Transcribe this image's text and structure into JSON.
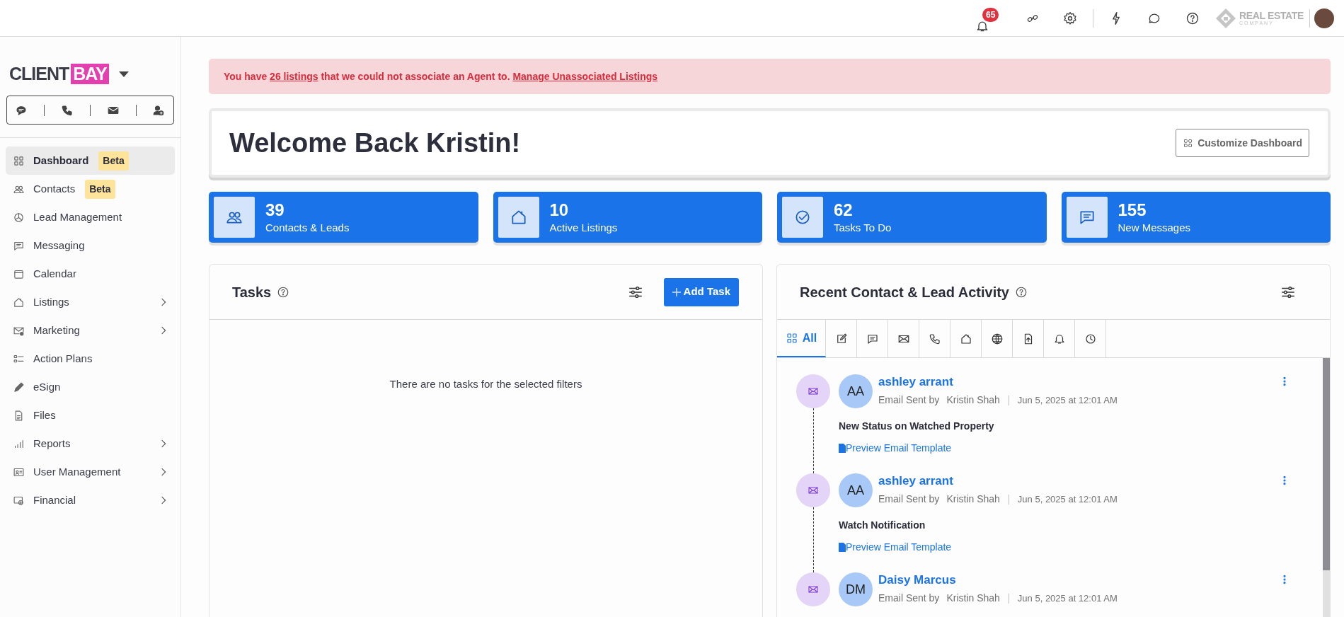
{
  "top_bar": {
    "notification_count": "65",
    "brand": {
      "name": "REAL ESTATE",
      "tagline": "COMPANY"
    }
  },
  "sidebar": {
    "logo": {
      "part_1": "CLIENT",
      "part_2": "BAY"
    },
    "items": [
      {
        "label": "Dashboard",
        "badge": "Beta",
        "selected": true,
        "has_submenu": false
      },
      {
        "label": "Contacts",
        "badge": "Beta",
        "selected": false,
        "has_submenu": false
      },
      {
        "label": "Lead Management",
        "selected": false,
        "has_submenu": false
      },
      {
        "label": "Messaging",
        "selected": false,
        "has_submenu": false
      },
      {
        "label": "Calendar",
        "selected": false,
        "has_submenu": false
      },
      {
        "label": "Listings",
        "selected": false,
        "has_submenu": true
      },
      {
        "label": "Marketing",
        "selected": false,
        "has_submenu": true
      },
      {
        "label": "Action Plans",
        "selected": false,
        "has_submenu": false
      },
      {
        "label": "eSign",
        "selected": false,
        "has_submenu": false
      },
      {
        "label": "Files",
        "selected": false,
        "has_submenu": false
      },
      {
        "label": "Reports",
        "selected": false,
        "has_submenu": true
      },
      {
        "label": "User Management",
        "selected": false,
        "has_submenu": true
      },
      {
        "label": "Financial",
        "selected": false,
        "has_submenu": true
      }
    ]
  },
  "alert": {
    "text_1": "You have",
    "link_1": "26 listings",
    "text_2": "that we could not associate an Agent to.",
    "link_2": "Manage Unassociated Listings"
  },
  "welcome": {
    "title": "Welcome Back Kristin!",
    "button": "Customize Dashboard"
  },
  "stats": [
    {
      "value": "39",
      "label": "Contacts & Leads"
    },
    {
      "value": "10",
      "label": "Active Listings"
    },
    {
      "value": "62",
      "label": "Tasks To Do"
    },
    {
      "value": "155",
      "label": "New Messages"
    }
  ],
  "tasks": {
    "title": "Tasks",
    "add_button": "Add Task",
    "empty_text": "There are no tasks for the selected filters"
  },
  "activity": {
    "title": "Recent Contact & Lead Activity",
    "tabs": [
      {
        "label": "All",
        "selected": true
      },
      {
        "selected": false
      },
      {
        "selected": false
      },
      {
        "selected": false
      },
      {
        "selected": false
      },
      {
        "selected": false
      },
      {
        "selected": false
      },
      {
        "selected": false
      },
      {
        "selected": false
      },
      {
        "selected": false
      }
    ],
    "entries": [
      {
        "initials": "AA",
        "name": "ashley arrant",
        "action": "Email Sent by",
        "author": "Kristin Shah",
        "time": "Jun 5, 2025 at 12:01 AM",
        "subject": "New Status on Watched Property",
        "link": "Preview Email Template"
      },
      {
        "initials": "AA",
        "name": "ashley arrant",
        "action": "Email Sent by",
        "author": "Kristin Shah",
        "time": "Jun 5, 2025 at 12:01 AM",
        "subject": "Watch Notification",
        "link": "Preview Email Template"
      },
      {
        "initials": "DM",
        "name": "Daisy Marcus",
        "action": "Email Sent by",
        "author": "Kristin Shah",
        "time": "Jun 5, 2025 at 12:01 AM"
      }
    ]
  }
}
